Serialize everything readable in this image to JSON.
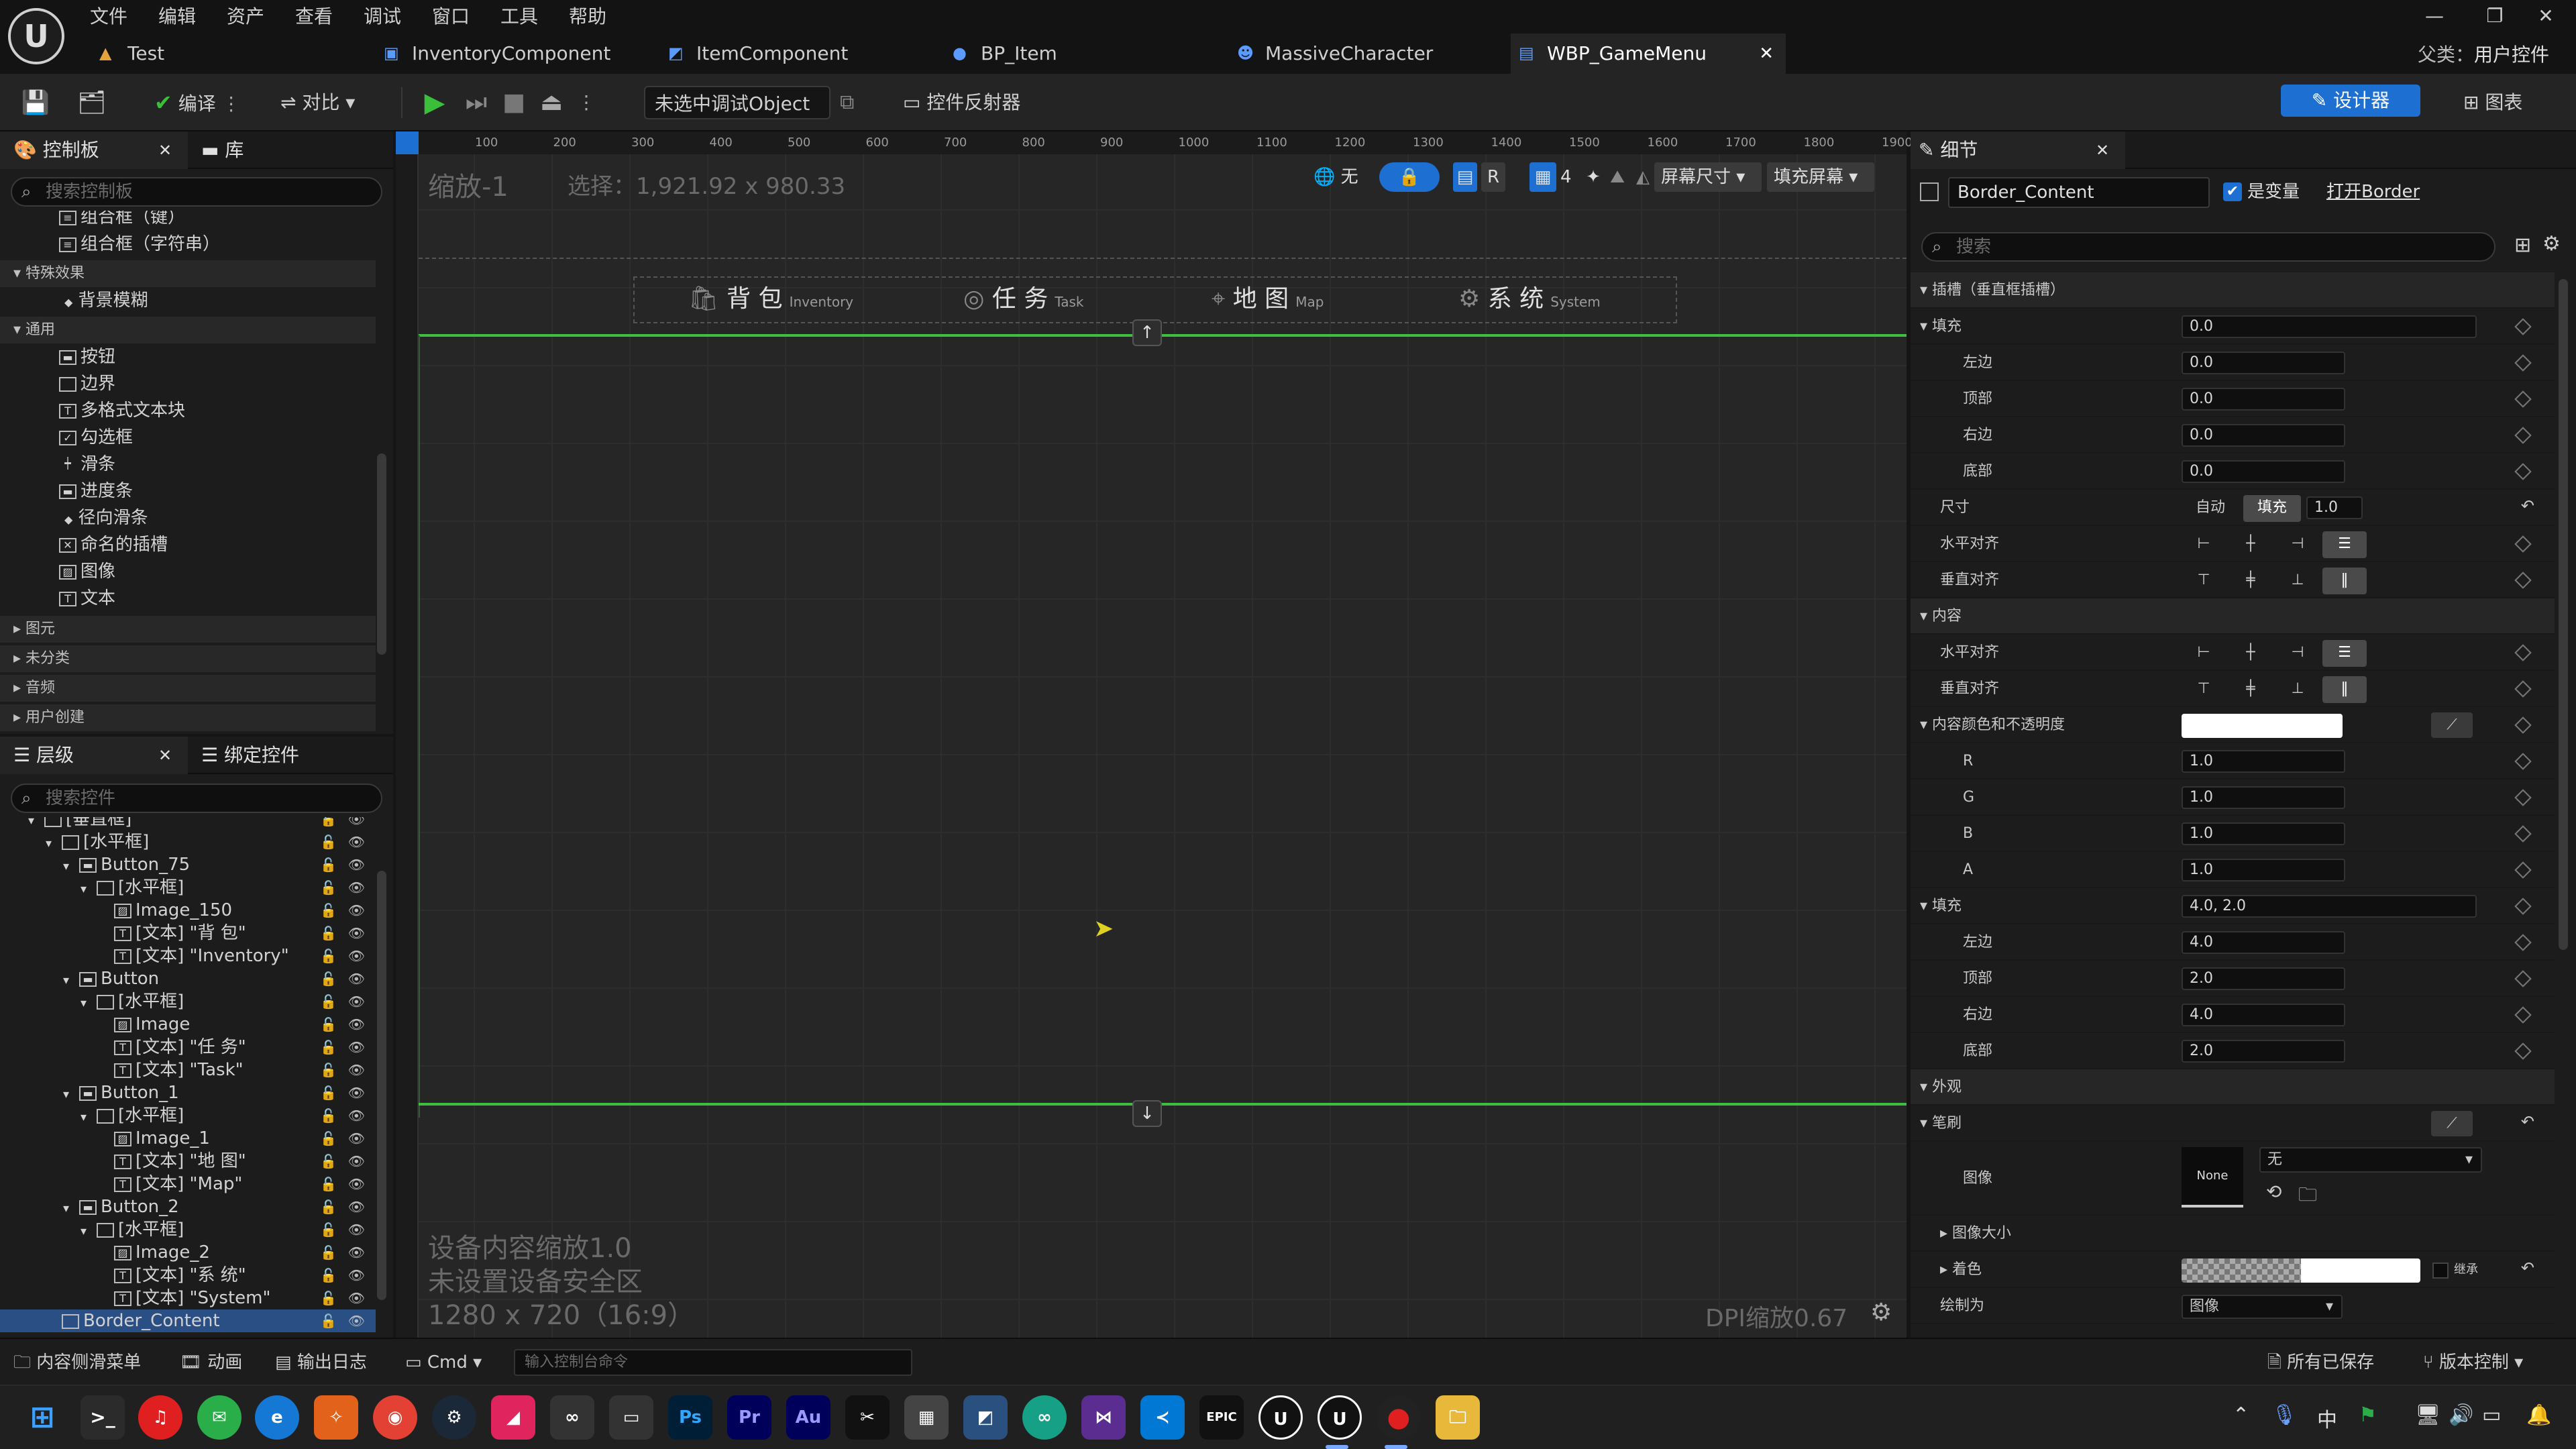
{
  "menus": [
    "文件",
    "编辑",
    "资产",
    "查看",
    "调试",
    "窗口",
    "工具",
    "帮助"
  ],
  "tabs": [
    {
      "label": "Test",
      "icon": "level-icon"
    },
    {
      "label": "InventoryComponent",
      "icon": "component-icon"
    },
    {
      "label": "ItemComponent",
      "icon": "component-icon"
    },
    {
      "label": "BP_Item",
      "icon": "blueprint-icon"
    },
    {
      "label": "MassiveCharacter",
      "icon": "character-icon"
    },
    {
      "label": "WBP_GameMenu",
      "icon": "widget-icon",
      "active": true
    }
  ],
  "parent_class": {
    "label": "父类：",
    "value": "用户控件"
  },
  "toolbar": {
    "compile": "编译",
    "diff": "对比",
    "debug_object": "未选中调试Object",
    "widget_reflector": "控件反射器",
    "designer": "设计器",
    "graph": "图表"
  },
  "palette": {
    "tab_palette": "控制板",
    "tab_library": "库",
    "search_placeholder": "搜索控制板",
    "partial_items": [
      "组合框（键）",
      "组合框（字符串）"
    ],
    "cat_special": "特殊效果",
    "special_items": [
      "背景模糊"
    ],
    "cat_common": "通用",
    "common_items": [
      "按钮",
      "边界",
      "多格式文本块",
      "勾选框",
      "滑条",
      "进度条",
      "径向滑条",
      "命名的插槽",
      "图像",
      "文本"
    ],
    "collapsed_cats": [
      "图元",
      "未分类",
      "音频",
      "用户创建"
    ]
  },
  "hierarchy": {
    "tab_hierarchy": "层级",
    "tab_bindings": "绑定控件",
    "search_placeholder": "搜索控件",
    "rows": [
      {
        "label": "[垂直框]",
        "depth": 1
      },
      {
        "label": "[水平框]",
        "depth": 2
      },
      {
        "label": "Button_75",
        "depth": 3
      },
      {
        "label": "[水平框]",
        "depth": 4
      },
      {
        "label": "Image_150",
        "depth": 5
      },
      {
        "label": "[文本] \"背 包\"",
        "depth": 5
      },
      {
        "label": "[文本] \"Inventory\"",
        "depth": 5
      },
      {
        "label": "Button",
        "depth": 3
      },
      {
        "label": "[水平框]",
        "depth": 4
      },
      {
        "label": "Image",
        "depth": 5
      },
      {
        "label": "[文本] \"任 务\"",
        "depth": 5
      },
      {
        "label": "[文本] \"Task\"",
        "depth": 5
      },
      {
        "label": "Button_1",
        "depth": 3
      },
      {
        "label": "[水平框]",
        "depth": 4
      },
      {
        "label": "Image_1",
        "depth": 5
      },
      {
        "label": "[文本] \"地 图\"",
        "depth": 5
      },
      {
        "label": "[文本] \"Map\"",
        "depth": 5
      },
      {
        "label": "Button_2",
        "depth": 3
      },
      {
        "label": "[水平框]",
        "depth": 4
      },
      {
        "label": "Image_2",
        "depth": 5
      },
      {
        "label": "[文本] \"系 统\"",
        "depth": 5
      },
      {
        "label": "[文本] \"System\"",
        "depth": 5
      },
      {
        "label": "Border_Content",
        "depth": 2,
        "selected": true
      }
    ]
  },
  "viewport": {
    "zoom": "缩放-1",
    "selection": "选择：1,921.92 x 980.33",
    "ruler_ticks": [
      "100",
      "200",
      "300",
      "400",
      "500",
      "600",
      "700",
      "800",
      "900",
      "1000",
      "1100",
      "1200",
      "1300",
      "1400",
      "1500",
      "1600",
      "1700",
      "1800",
      "1900"
    ],
    "tools": {
      "none": "无",
      "r": "R",
      "grid": "4",
      "screen_size": "屏幕尺寸",
      "fill_screen": "填充屏幕"
    },
    "nav": [
      {
        "label": "背 包",
        "sub": "Inventory",
        "icon": "bag-icon"
      },
      {
        "label": "任 务",
        "sub": "Task",
        "icon": "task-icon"
      },
      {
        "label": "地 图",
        "sub": "Map",
        "icon": "map-pin-icon"
      },
      {
        "label": "系 统",
        "sub": "System",
        "icon": "gear-icon"
      }
    ],
    "up_arrow": "↑",
    "down_arrow": "↓",
    "info_lines": [
      "设备内容缩放1.0",
      "未设置设备安全区",
      "1280 x 720（16:9）"
    ],
    "dpi": "DPI缩放0.67"
  },
  "details": {
    "tab": "细节",
    "name_value": "Border_Content",
    "is_variable": "是变量",
    "open_border": "打开Border",
    "search_placeholder": "搜索",
    "slot_section": "插槽（垂直框插槽）",
    "padding_label": "填充",
    "padding_value": "0.0",
    "padding_sides": [
      {
        "label": "左边",
        "value": "0.0"
      },
      {
        "label": "顶部",
        "value": "0.0"
      },
      {
        "label": "右边",
        "value": "0.0"
      },
      {
        "label": "底部",
        "value": "0.0"
      }
    ],
    "size_label": "尺寸",
    "size_auto": "自动",
    "size_fill": "填充",
    "size_value": "1.0",
    "h_align": "水平对齐",
    "v_align": "垂直对齐",
    "content_section": "内容",
    "content_h_align": "水平对齐",
    "content_v_align": "垂直对齐",
    "content_color_label": "内容颜色和不透明度",
    "color_channels": [
      {
        "label": "R",
        "value": "1.0"
      },
      {
        "label": "G",
        "value": "1.0"
      },
      {
        "label": "B",
        "value": "1.0"
      },
      {
        "label": "A",
        "value": "1.0"
      }
    ],
    "padding2_label": "填充",
    "padding2_value": "4.0, 2.0",
    "padding2_sides": [
      {
        "label": "左边",
        "value": "4.0"
      },
      {
        "label": "顶部",
        "value": "2.0"
      },
      {
        "label": "右边",
        "value": "4.0"
      },
      {
        "label": "底部",
        "value": "2.0"
      }
    ],
    "appearance_section": "外观",
    "brush_label": "笔刷",
    "image_label": "图像",
    "image_thumb": "None",
    "image_select": "无",
    "image_size_label": "图像大小",
    "tint_label": "着色",
    "inherit_label": "继承",
    "draw_as_label": "绘制为",
    "draw_as_value": "图像"
  },
  "statusbar": {
    "content_drawer": "内容侧滑菜单",
    "animation": "动画",
    "output_log": "输出日志",
    "cmd": "Cmd",
    "console_placeholder": "输入控制台命令",
    "all_saved": "所有已保存",
    "source_control": "版本控制"
  },
  "taskbar_apps": [
    "windows-start-icon",
    "terminal-icon",
    "netease-music-icon",
    "wechat-icon",
    "edge-icon",
    "jetbrains-icon",
    "chrome-icon",
    "steam-icon",
    "app-icon",
    "meta-icon",
    "app-icon",
    "photoshop-icon",
    "premiere-icon",
    "audition-icon",
    "capcut-icon",
    "calculator-icon",
    "app-icon",
    "app-icon",
    "visual-studio-icon",
    "vscode-icon",
    "epic-games-icon",
    "unreal-icon",
    "unreal-icon",
    "record-icon",
    "explorer-icon"
  ],
  "taskbar_labels": {
    "ps": "Ps",
    "pr": "Pr",
    "au": "Au",
    "epic": "EPIC",
    "ime": "中"
  },
  "colors": {
    "accent": "#1e6fd2",
    "guide": "#3fbf3f",
    "play": "#3bbf3b"
  }
}
